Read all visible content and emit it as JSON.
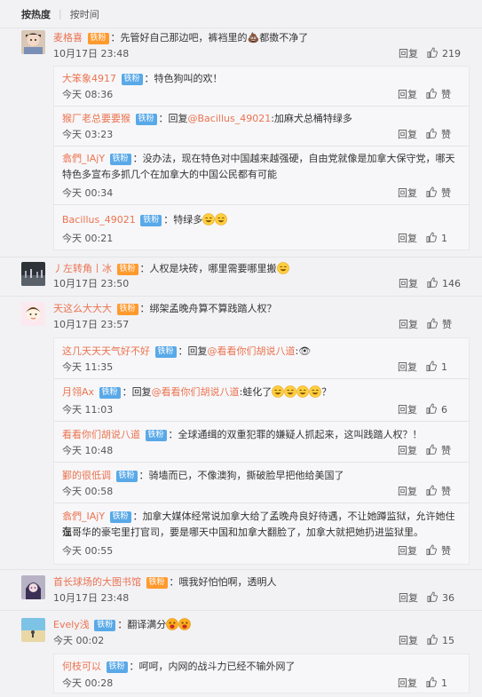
{
  "sort": {
    "active": "按热度",
    "inactive": "按时间"
  },
  "ui": {
    "reply": "回复",
    "like": "赞"
  },
  "comments": [
    {
      "user": "麦格喜",
      "badge": "铁粉",
      "sep": "：",
      "text": "先管好自己那边吧，裤裆里的💩都擞不净了",
      "time": "10月17日 23:48",
      "likes": "219",
      "replies": [
        {
          "user": "大笨象4917",
          "badge": "铁粉",
          "sep": "：",
          "text": "特色狗叫的欢！",
          "time": "今天 08:36",
          "likes": "赞"
        },
        {
          "user": "猴厂老总要要猴",
          "badge": "铁粉",
          "sep": "：",
          "pre": "回复",
          "mention": "@Bacillus_49021",
          "text": ":加麻犬总桶特绿多",
          "time": "今天 03:23",
          "likes": "赞"
        },
        {
          "user": "翕們_IAjY",
          "badge": "铁粉",
          "sep": "：",
          "text": "没办法，现在特色对中国越来越强硬，自由党就像是加拿大保守党，哪天",
          "text2": "特色多宣布多抓几个在加拿大的中国公民都有可能",
          "time": "今天 00:34",
          "likes": "赞"
        },
        {
          "user": "Bacillus_49021",
          "badge": "铁粉",
          "sep": "：",
          "text": "特绿多",
          "time": "今天 00:21",
          "likes": "1"
        }
      ]
    },
    {
      "user": "丿左转角丨冰",
      "badge": "铁粉",
      "sep": "：",
      "text": "人权是块砖，哪里需要哪里搬",
      "time": "10月17日 23:50",
      "likes": "146"
    },
    {
      "user": "天这么大大大",
      "badge": "铁粉",
      "sep": "：",
      "text": "绑架孟晚舟算不算践踏人权？",
      "time": "10月17日 23:57",
      "likes": "赞",
      "replies": [
        {
          "user": "这几天天天气好不好",
          "badge": "铁粉",
          "sep": "：",
          "pre": "回复",
          "mention": "@看看你们胡说八道",
          "text": ":👁",
          "time": "今天 11:35",
          "likes": "1"
        },
        {
          "user": "月翎Ax",
          "badge": "铁粉",
          "sep": "：",
          "pre": "回复",
          "mention": "@看看你们胡说八道",
          "text": ":蛙化了",
          "text_after": "？",
          "time": "今天 11:03",
          "likes": "6"
        },
        {
          "user": "看看你们胡说八道",
          "badge": "铁粉",
          "sep": "：",
          "text": "全球通缉的双重犯罪的嫌疑人抓起来，这叫践踏人权？！",
          "time": "今天 10:48",
          "likes": "赞"
        },
        {
          "user": "鄞的很低调",
          "badge": "铁粉",
          "sep": "：",
          "text": "骑墙而已，不像澳狗，撕破脸早把他给美国了",
          "time": "今天 00:58",
          "likes": "赞"
        },
        {
          "user": "翕們_IAjY",
          "badge": "铁粉",
          "sep": "：",
          "text": "加拿大媒体经常说加拿大给了孟晚舟良好待遇，不让她蹲监狱，允许她住在",
          "text2": "温哥华的豪宅里打官司，要是哪天中国和加拿大翻脸了，加拿大就把她扔进监狱里。",
          "time": "今天 00:55",
          "likes": "赞"
        }
      ]
    },
    {
      "user": "首长球场的大图书馆",
      "badge": "铁粉",
      "sep": "：",
      "text": "哦我好怕怕啊，透明人",
      "time": "10月17日 23:48",
      "likes": "36"
    },
    {
      "user": "Evely浅",
      "badge": "铁粉",
      "sep": "：",
      "text": "翻译满分",
      "time": "今天 00:02",
      "likes": "15",
      "replies": [
        {
          "user": "何枝可以",
          "badge": "铁粉",
          "sep": "：",
          "text": "呵呵，内网的战斗力已经不输外网了",
          "time": "今天 00:28",
          "likes": "1"
        }
      ]
    }
  ]
}
